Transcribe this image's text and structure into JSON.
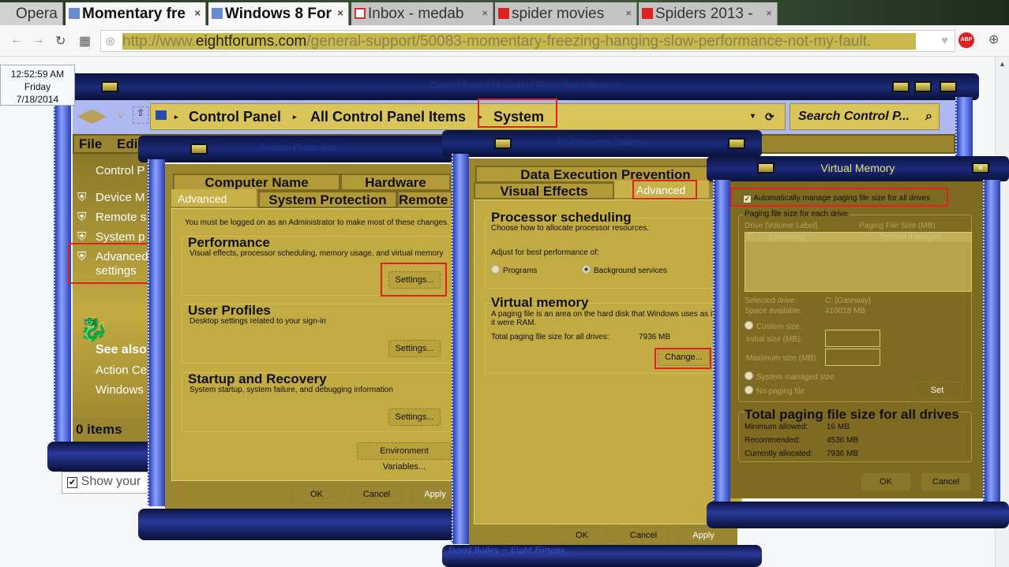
{
  "browser": {
    "tabs": [
      {
        "label": "Opera",
        "state": "menu"
      },
      {
        "label": "Momentary fre",
        "state": "active"
      },
      {
        "label": "Windows 8 For",
        "state": "active"
      },
      {
        "label": "Inbox - medab",
        "state": "inactive"
      },
      {
        "label": "spider movies",
        "state": "inactive"
      },
      {
        "label": "Spiders 2013 -",
        "state": "inactive"
      }
    ],
    "close_glyph": "×",
    "url_prefix": "http://www.",
    "url_domain": "eightforums.com",
    "url_path": "/general-support/50083-momentary-freezing-hanging-slow-performance-not-my-fault.",
    "adblock": "ABP"
  },
  "clock": {
    "time": "12:52:59 AM",
    "day": "Friday",
    "date": "7/18/2014"
  },
  "control_panel": {
    "title": "Control Panel\\All Control Panel Items\\System",
    "breadcrumb": [
      "Control Panel",
      "All Control Panel Items",
      "System"
    ],
    "search_placeholder": "Search Control P...",
    "menu": [
      "File",
      "Edit"
    ],
    "left_home": "Control P",
    "left_links": [
      "Device M",
      "Remote s",
      "System p",
      "Advanced",
      "settings"
    ],
    "see_also": "See also",
    "see_also_links": [
      "Action Ce",
      "Windows"
    ],
    "status": "0 items",
    "show_your": "Show your"
  },
  "system_properties": {
    "title": "System Properties",
    "tabs_back": [
      "Computer Name",
      "Hardware"
    ],
    "tabs_front": [
      "Advanced",
      "System Protection",
      "Remote"
    ],
    "admin_note": "You must be logged on as an Administrator to make most of these changes.",
    "sections": [
      {
        "title": "Performance",
        "desc": "Visual effects, processor scheduling, memory usage, and virtual memory",
        "button": "Settings..."
      },
      {
        "title": "User Profiles",
        "desc": "Desktop settings related to your sign-in",
        "button": "Settings..."
      },
      {
        "title": "Startup and Recovery",
        "desc": "System startup, system failure, and debugging information",
        "button": "Settings..."
      }
    ],
    "env_button": "Environment Variables...",
    "ok": "OK",
    "cancel": "Cancel",
    "apply": "Apply"
  },
  "performance_options": {
    "title": "Performance Options",
    "tabs_back": [
      "Data Execution Prevention"
    ],
    "tabs_front": [
      "Visual Effects",
      "Advanced"
    ],
    "proc_title": "Processor scheduling",
    "proc_desc": "Choose how to allocate processor resources.",
    "adjust_label": "Adjust for best performance of:",
    "radio_programs": "Programs",
    "radio_background": "Background services",
    "selected": "Background services",
    "vm_title": "Virtual memory",
    "vm_desc": "A paging file is an area on the hard disk that Windows uses as if it were RAM.",
    "vm_total_label": "Total paging file size for all drives:",
    "vm_total_value": "7936 MB",
    "change_button": "Change...",
    "ok": "OK",
    "cancel": "Cancel",
    "apply": "Apply",
    "watermark": "David Bailey ~ Eight Forums"
  },
  "virtual_memory": {
    "title": "Virtual Memory",
    "auto_manage": "Automatically manage paging file size for all drives",
    "auto_checked": true,
    "group_label": "Paging file size for each drive",
    "col_drive": "Drive  [Volume Label]",
    "col_size": "Paging File Size (MB)",
    "row_drive": "C:",
    "row_label": "[Gateway]",
    "row_size": "System managed",
    "selected_drive_label": "Selected drive:",
    "selected_drive_value": "C:  [Gateway]",
    "space_label": "Space available:",
    "space_value": "410018 MB",
    "custom_size": "Custom size:",
    "initial_label": "Initial size (MB):",
    "max_label": "Maximum size (MB):",
    "system_managed": "System managed size",
    "no_paging": "No paging file",
    "set_button": "Set",
    "total_title": "Total paging file size for all drives",
    "min_label": "Minimum allowed:",
    "min_value": "16 MB",
    "rec_label": "Recommended:",
    "rec_value": "4536 MB",
    "cur_label": "Currently allocated:",
    "cur_value": "7936 MB",
    "ok": "OK",
    "cancel": "Cancel"
  },
  "colors": {
    "highlight_box": "#dd2222",
    "panel_gold": "#c2ab42",
    "frame_navy": "#101a50"
  }
}
